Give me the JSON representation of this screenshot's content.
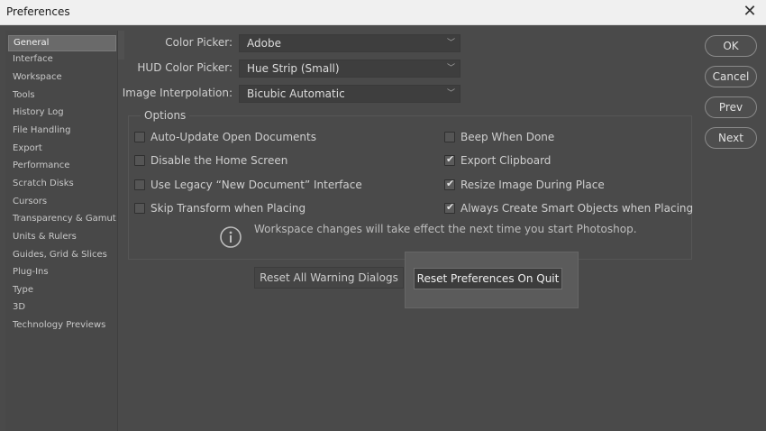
{
  "window": {
    "title": "Preferences",
    "close_glyph": "✕"
  },
  "sidebar": {
    "items": [
      "General",
      "Interface",
      "Workspace",
      "Tools",
      "History Log",
      "File Handling",
      "Export",
      "Performance",
      "Scratch Disks",
      "Cursors",
      "Transparency & Gamut",
      "Units & Rulers",
      "Guides, Grid & Slices",
      "Plug-Ins",
      "Type",
      "3D",
      "Technology Previews"
    ],
    "selected": "General"
  },
  "fields": {
    "color_picker": {
      "label": "Color Picker:",
      "value": "Adobe"
    },
    "hud_color_picker": {
      "label": "HUD Color Picker:",
      "value": "Hue Strip (Small)"
    },
    "image_interpolation": {
      "label": "Image Interpolation:",
      "value": "Bicubic Automatic"
    }
  },
  "options": {
    "title": "Options",
    "left": [
      {
        "label": "Auto-Update Open Documents",
        "checked": false
      },
      {
        "label": "Disable the Home Screen",
        "checked": false
      },
      {
        "label": "Use Legacy “New Document” Interface",
        "checked": false
      },
      {
        "label": "Skip Transform when Placing",
        "checked": false
      }
    ],
    "right": [
      {
        "label": "Beep When Done",
        "checked": false
      },
      {
        "label": "Export Clipboard",
        "checked": true
      },
      {
        "label": "Resize Image During Place",
        "checked": true
      },
      {
        "label": "Always Create Smart Objects when Placing",
        "checked": true
      }
    ]
  },
  "info": {
    "text": "Workspace changes will take effect the next time you start Photoshop."
  },
  "buttons": {
    "reset_warnings": "Reset All Warning Dialogs",
    "reset_prefs": "Reset Preferences On Quit",
    "ok": "OK",
    "cancel": "Cancel",
    "prev": "Prev",
    "next": "Next"
  },
  "colors": {
    "background": "#4a4a4a",
    "titlebar": "#f0f0f0",
    "highlight": "#5b5b5b"
  }
}
